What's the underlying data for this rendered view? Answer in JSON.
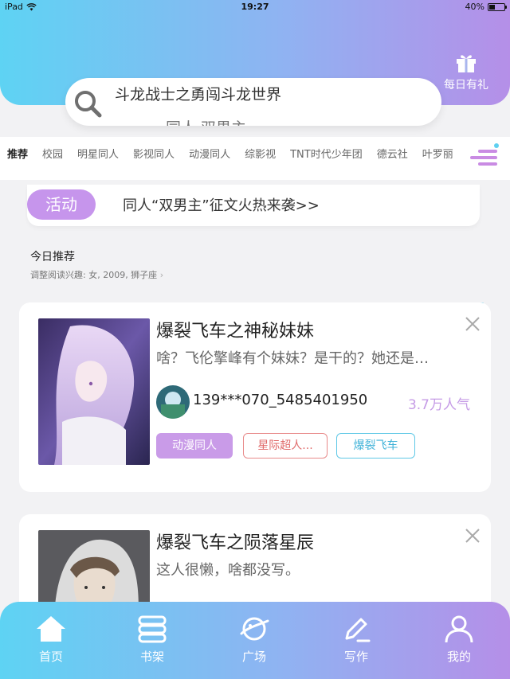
{
  "status_bar": {
    "device": "iPad",
    "time": "19:27",
    "battery": "40%",
    "battery_level": 0.4
  },
  "header": {
    "gift_label": "每日有礼",
    "search": {
      "current_suggestion": "斗龙战士之勇闯斗龙世界",
      "next_suggestion": "同人·双男主"
    }
  },
  "tabs": [
    "推荐",
    "校园",
    "明星同人",
    "影视同人",
    "动漫同人",
    "综影视",
    "TNT时代少年团",
    "德云社",
    "叶罗丽"
  ],
  "activity": {
    "badge": "活动",
    "message": "同人“双男主”征文火热来袭>>"
  },
  "recommend": {
    "title": "今日推荐",
    "subtitle": "调整阅读兴趣: 女, 2009, 狮子座"
  },
  "books": [
    {
      "title": "爆裂飞车之神秘妹妹",
      "desc": "啥？飞伦擎峰有个妹妹？是干的？她还是…",
      "author": "139***070_5485401950",
      "popularity": "3.7万人气",
      "tags": [
        "动漫同人",
        "星际超人...",
        "爆裂飞车"
      ]
    },
    {
      "title": "爆裂飞车之陨落星辰",
      "desc": "这人很懒，啥都没写。"
    }
  ],
  "bottom_nav": [
    {
      "label": "首页",
      "icon": "home-icon"
    },
    {
      "label": "书架",
      "icon": "bookshelf-icon"
    },
    {
      "label": "广场",
      "icon": "planet-icon"
    },
    {
      "label": "写作",
      "icon": "pen-icon"
    },
    {
      "label": "我的",
      "icon": "profile-icon"
    }
  ],
  "colors": {
    "gradient_start": "#5ed3f3",
    "gradient_end": "#b58fe8",
    "accent_purple": "#c695ec",
    "tag_purple": "#c99be8",
    "tag_red": "#e88a8a",
    "tag_cyan": "#5fc8e6"
  }
}
